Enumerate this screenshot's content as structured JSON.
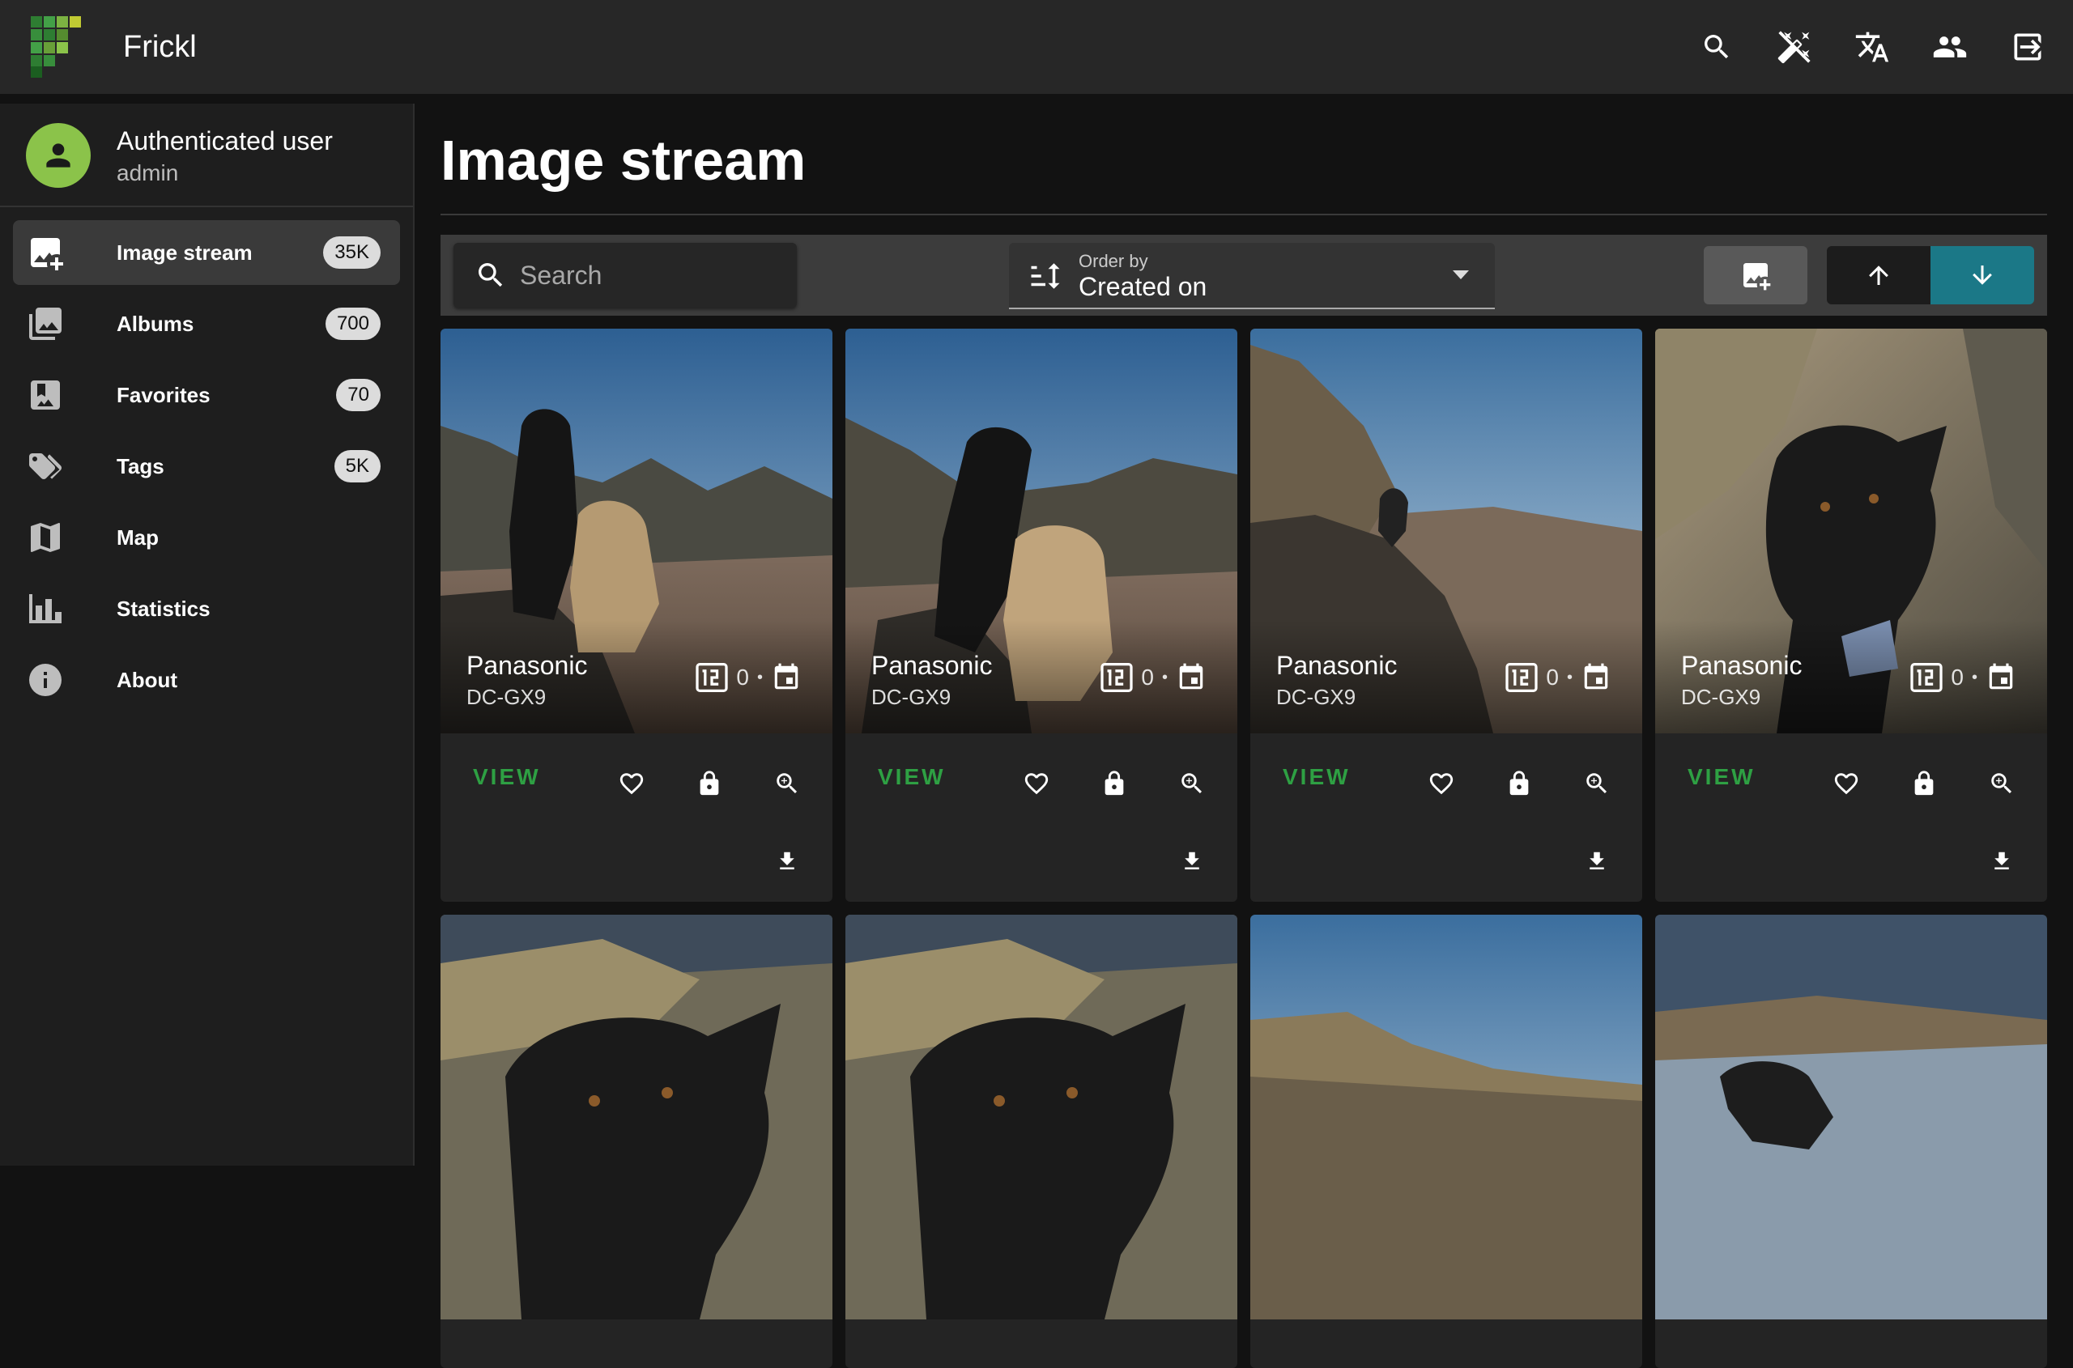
{
  "app": {
    "title": "Frickl",
    "brand_color": "#8bc34a"
  },
  "appbar": {
    "icons": [
      "search-icon",
      "magic-off-icon",
      "translate-icon",
      "people-icon",
      "logout-icon"
    ]
  },
  "user": {
    "name": "Authenticated user",
    "role": "admin"
  },
  "sidebar": {
    "items": [
      {
        "label": "Image stream",
        "badge": "35K",
        "icon": "image-plus-icon",
        "active": true
      },
      {
        "label": "Albums",
        "badge": "700",
        "icon": "image-multiple-icon"
      },
      {
        "label": "Favorites",
        "badge": "70",
        "icon": "bookmark-image-icon"
      },
      {
        "label": "Tags",
        "badge": "5K",
        "icon": "tag-multiple-icon"
      },
      {
        "label": "Map",
        "icon": "map-icon"
      },
      {
        "label": "Statistics",
        "icon": "chart-bar-icon"
      },
      {
        "label": "About",
        "icon": "info-icon"
      }
    ]
  },
  "main": {
    "title": "Image stream",
    "toolbar": {
      "search_placeholder": "Search",
      "order_label": "Order by",
      "order_value": "Created on",
      "sort_desc_color": "#1b7887"
    },
    "photos": [
      {
        "make": "Panasonic",
        "model": "DC-GX9",
        "count": "0",
        "view_label": "VIEW",
        "scene": "two-dogs-beach"
      },
      {
        "make": "Panasonic",
        "model": "DC-GX9",
        "count": "0",
        "view_label": "VIEW",
        "scene": "two-dogs-beach-close"
      },
      {
        "make": "Panasonic",
        "model": "DC-GX9",
        "count": "0",
        "view_label": "VIEW",
        "scene": "dog-on-rock-beach"
      },
      {
        "make": "Panasonic",
        "model": "DC-GX9",
        "count": "0",
        "view_label": "VIEW",
        "scene": "black-dog-portrait"
      },
      {
        "scene": "black-dog-closeup"
      },
      {
        "scene": "black-dog-closeup"
      },
      {
        "scene": "cliffs-sky"
      },
      {
        "scene": "dog-on-shore"
      }
    ]
  }
}
